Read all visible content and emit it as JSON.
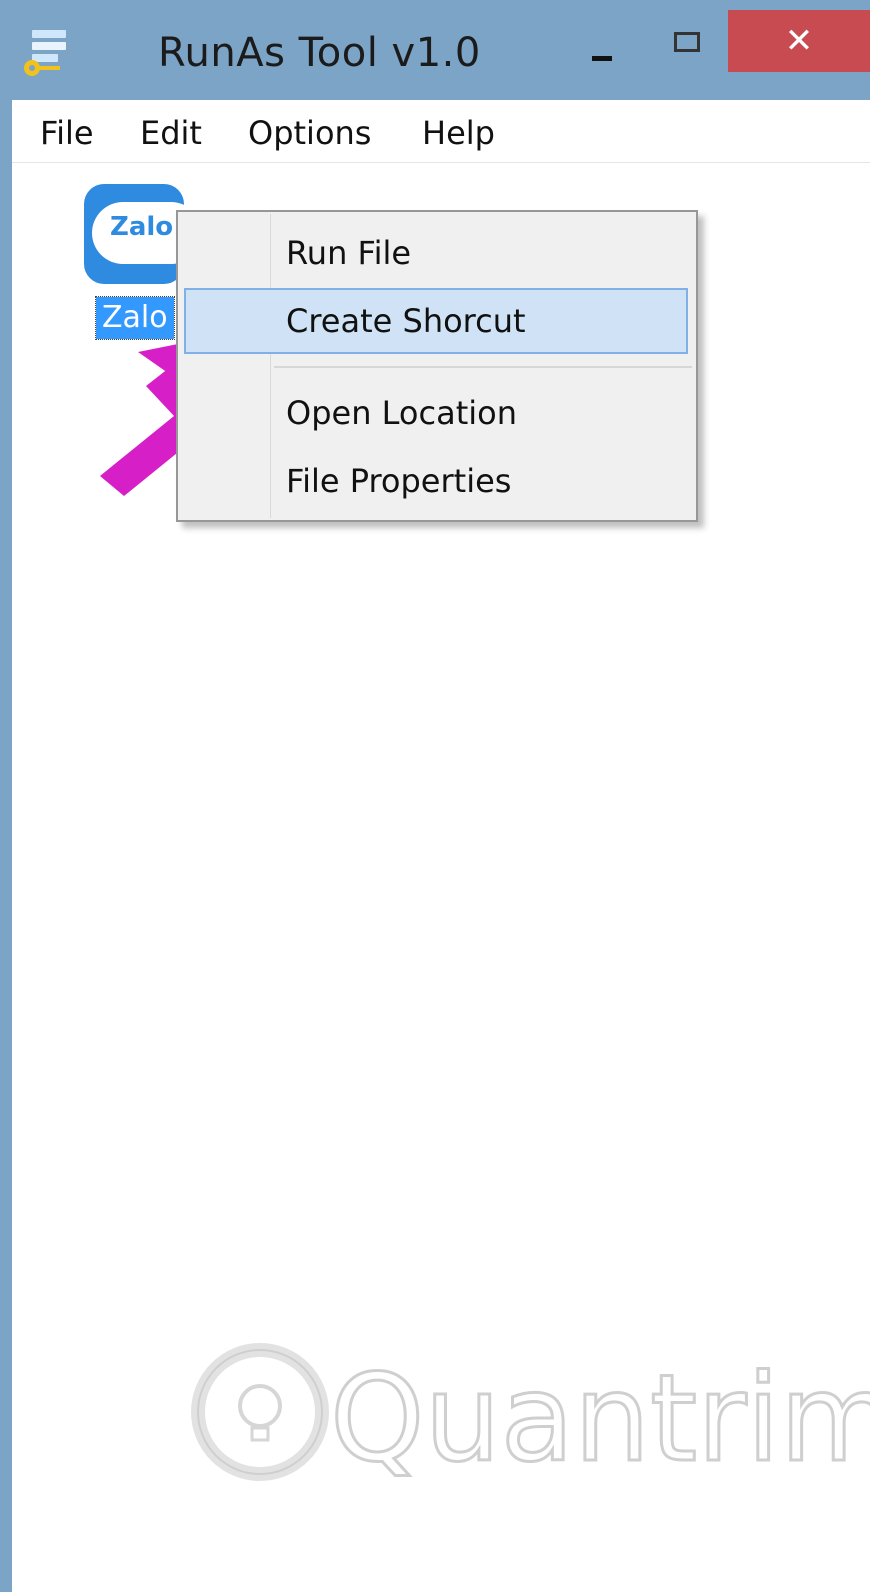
{
  "window": {
    "title": "RunAs Tool v1.0",
    "close_glyph": "✕"
  },
  "menubar": {
    "items": [
      "File",
      "Edit",
      "Options",
      "Help"
    ]
  },
  "file_item": {
    "label": "Zalo",
    "icon_text": "Zalo"
  },
  "context_menu": {
    "items": [
      "Run File",
      "Create Shorcut",
      "Open Location",
      "File Properties"
    ]
  },
  "watermark": "Quantrimang",
  "colors": {
    "titlebar": "#7ba4c6",
    "close_button": "#c74b50",
    "selection": "#3399ff",
    "menu_highlight": "#d0e3f6",
    "arrow": "#d61fc6",
    "zalo_brand": "#2e8be0"
  },
  "icons": {
    "app": "runas-app-icon",
    "zalo": "zalo-app-icon",
    "annotation": "pointer-arrow-icon"
  }
}
